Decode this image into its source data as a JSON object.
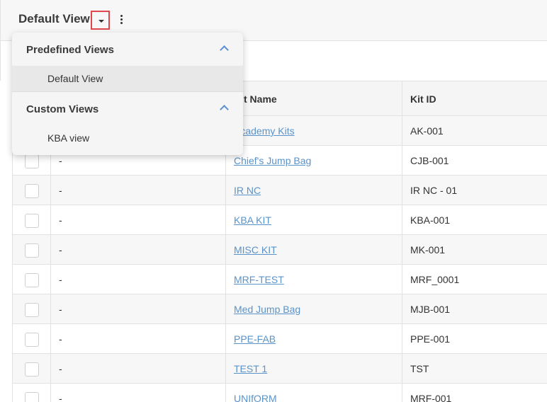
{
  "header": {
    "view_title": "Default View"
  },
  "dropdown": {
    "sections": [
      {
        "label": "Predefined Views",
        "items": [
          {
            "label": "Default View",
            "selected": true
          }
        ]
      },
      {
        "label": "Custom Views",
        "items": [
          {
            "label": "KBA view",
            "selected": false
          }
        ]
      }
    ]
  },
  "table": {
    "columns": {
      "kit_name": "Kit Name",
      "kit_id": "Kit ID"
    },
    "rows": [
      {
        "desc": "",
        "name": "Academy Kits",
        "id": "AK-001"
      },
      {
        "desc": "-",
        "name": "Chief's Jump Bag",
        "id": "CJB-001"
      },
      {
        "desc": "-",
        "name": "IR NC",
        "id": "IR NC - 01"
      },
      {
        "desc": "-",
        "name": "KBA KIT",
        "id": "KBA-001"
      },
      {
        "desc": "-",
        "name": "MISC KIT",
        "id": "MK-001"
      },
      {
        "desc": "-",
        "name": "MRF-TEST",
        "id": "MRF_0001"
      },
      {
        "desc": "-",
        "name": "Med Jump Bag",
        "id": "MJB-001"
      },
      {
        "desc": "-",
        "name": "PPE-FAB",
        "id": "PPE-001"
      },
      {
        "desc": "-",
        "name": "TEST 1",
        "id": "TST"
      },
      {
        "desc": "-",
        "name": "UNIfORM",
        "id": "MRF-001"
      }
    ]
  },
  "colors": {
    "link": "#5a93c9",
    "highlight_border": "#e0474c",
    "chevron": "#5a8fd8"
  },
  "icons": {
    "view_caret": "caret-down-icon",
    "more": "vertical-ellipsis-icon",
    "collapse": "chevron-up-icon"
  }
}
